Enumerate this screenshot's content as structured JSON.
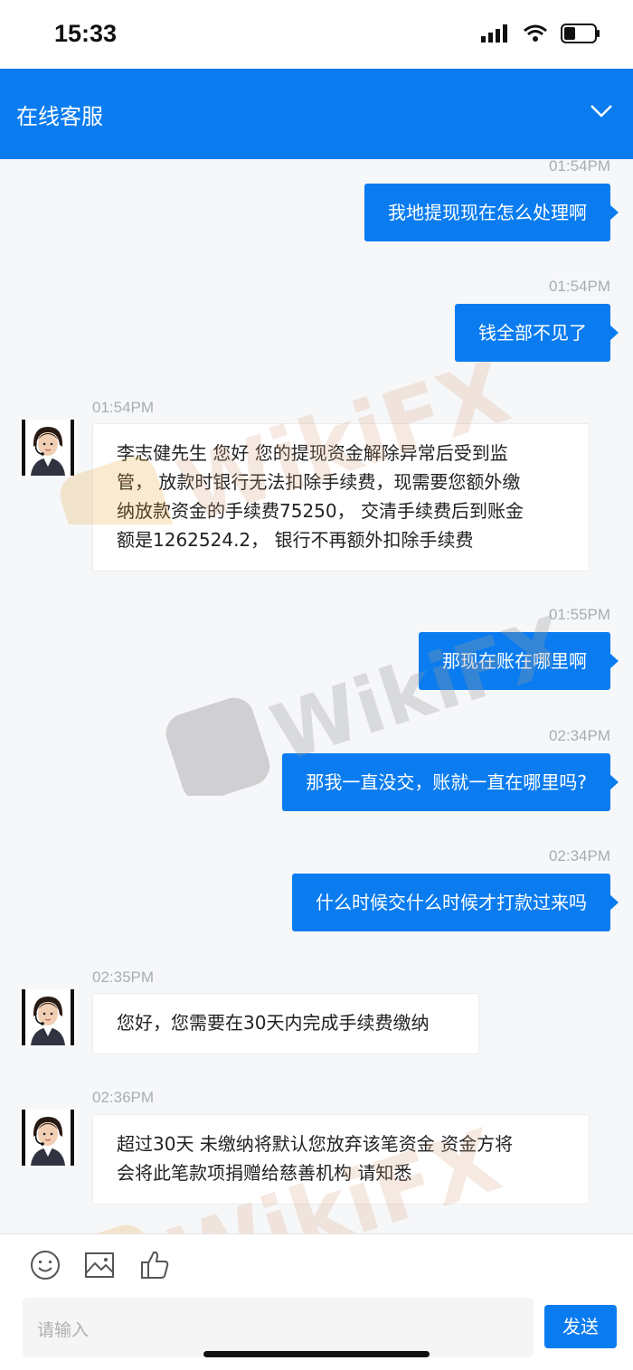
{
  "status_bar": {
    "time": "15:33"
  },
  "header": {
    "title": "在线客服",
    "chevron_icon": "chevron-down-icon"
  },
  "watermark": {
    "text": "WikiFX"
  },
  "messages": [
    {
      "side": "out",
      "time": "01:54PM",
      "text": "我地提现现在怎么处理啊"
    },
    {
      "side": "out",
      "time": "01:54PM",
      "text": "钱全部不见了"
    },
    {
      "side": "in",
      "time": "01:54PM",
      "lines": [
        "李志健先生 您好 您的提现资金解除异常后受到监",
        "管， 放款时银行无法扣除手续费，现需要您额外缴",
        "纳放款资金的手续费75250， 交清手续费后到账金",
        "额是1262524.2， 银行不再额外扣除手续费"
      ]
    },
    {
      "side": "out",
      "time": "01:55PM",
      "text": "那现在账在哪里啊"
    },
    {
      "side": "out",
      "time": "02:34PM",
      "text": "那我一直没交，账就一直在哪里吗?"
    },
    {
      "side": "out",
      "time": "02:34PM",
      "text": "什么时候交什么时候才打款过来吗"
    },
    {
      "side": "in",
      "time": "02:35PM",
      "lines": [
        "您好，您需要在30天内完成手续费缴纳"
      ]
    },
    {
      "side": "in",
      "time": "02:36PM",
      "lines": [
        "超过30天 未缴纳将默认您放弃该笔资金 资金方将",
        "会将此笔款项捐赠给慈善机构 请知悉"
      ]
    }
  ],
  "input": {
    "placeholder": "请输入",
    "send_label": "发送",
    "tools": [
      "emoji-icon",
      "image-icon",
      "thumbs-up-icon"
    ]
  },
  "colors": {
    "accent": "#0a7cf0",
    "background": "#f6f7f9"
  }
}
